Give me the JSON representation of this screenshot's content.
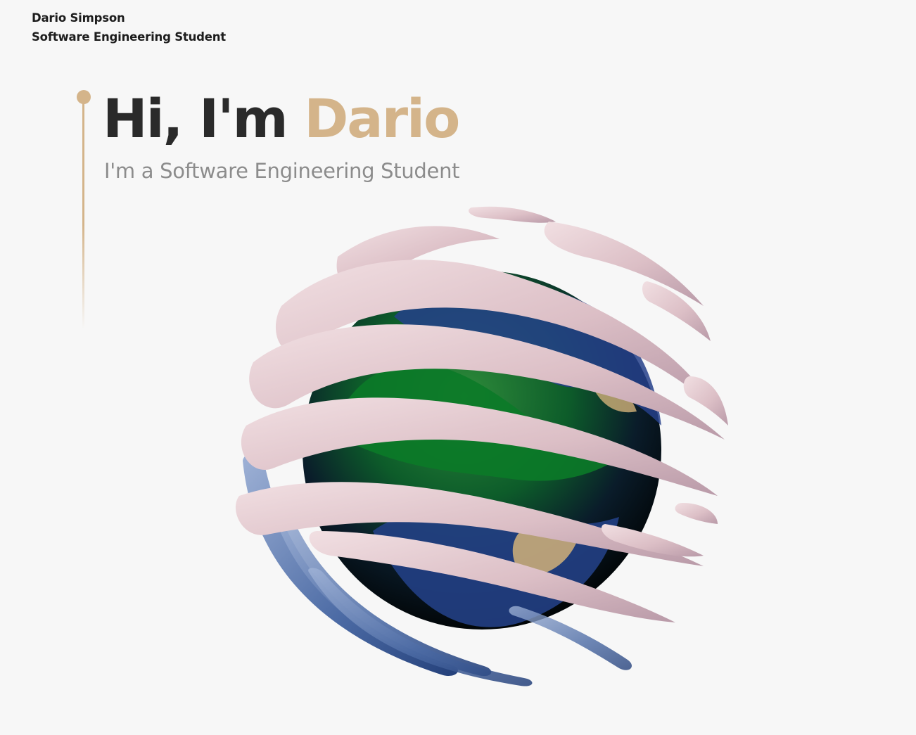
{
  "header": {
    "name": "Dario Simpson",
    "role": "Software Engineering Student"
  },
  "hero": {
    "greeting": "Hi, I'm",
    "highlight_name": "Dario",
    "subtitle": "I'm a Software Engineering Student"
  },
  "colors": {
    "accent": "#d4b48a",
    "background": "#f7f7f7",
    "text_dark": "#2a2a2a",
    "subtitle": "#8c8c8c"
  },
  "scene": {
    "icon": "globe-with-cloud-ribbons"
  }
}
